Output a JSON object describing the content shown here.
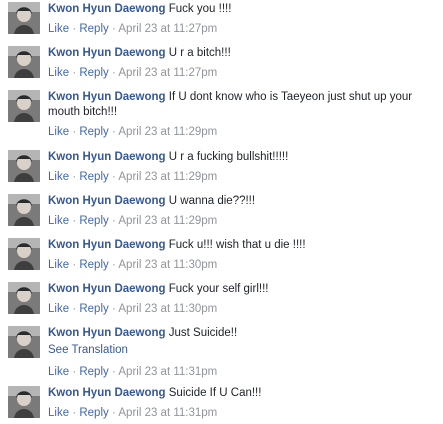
{
  "author_name": "Kwon Hyun Daewong",
  "like_label": "Like",
  "reply_label": "Reply",
  "separator": "·",
  "avatar_icon": "profile-photo-icon",
  "colors": {
    "author": "#365899",
    "link": "#4267b2",
    "meta": "#90949c",
    "text": "#1d2129"
  },
  "comments": [
    {
      "text": "Fuck you !!!!",
      "timestamp": "April 23 at 11:27pm"
    },
    {
      "text": "U r a bitch!!!",
      "timestamp": "April 23 at 11:27pm"
    },
    {
      "text": "If U dont know who is Taeyeon just shut up your mouth bitch!!!",
      "timestamp": "April 23 at 11:29pm"
    },
    {
      "text": "U r a fucking bullshit!!!!!",
      "timestamp": "April 23 at 11:29pm"
    },
    {
      "text": "U wanna die??!!!",
      "timestamp": "April 23 at 11:29pm"
    },
    {
      "text": "Fuck u!!! wish that u die !!!!",
      "timestamp": "April 23 at 11:30pm"
    },
    {
      "text": "Fuck your self girl!!!",
      "timestamp": "April 23 at 11:30pm"
    },
    {
      "text": "Just Suicide!!",
      "translation_link": "See Translation",
      "timestamp": "April 23 at 11:31pm"
    },
    {
      "text": "Suicide If U Can!!!",
      "timestamp": "April 23 at 11:31pm"
    }
  ]
}
